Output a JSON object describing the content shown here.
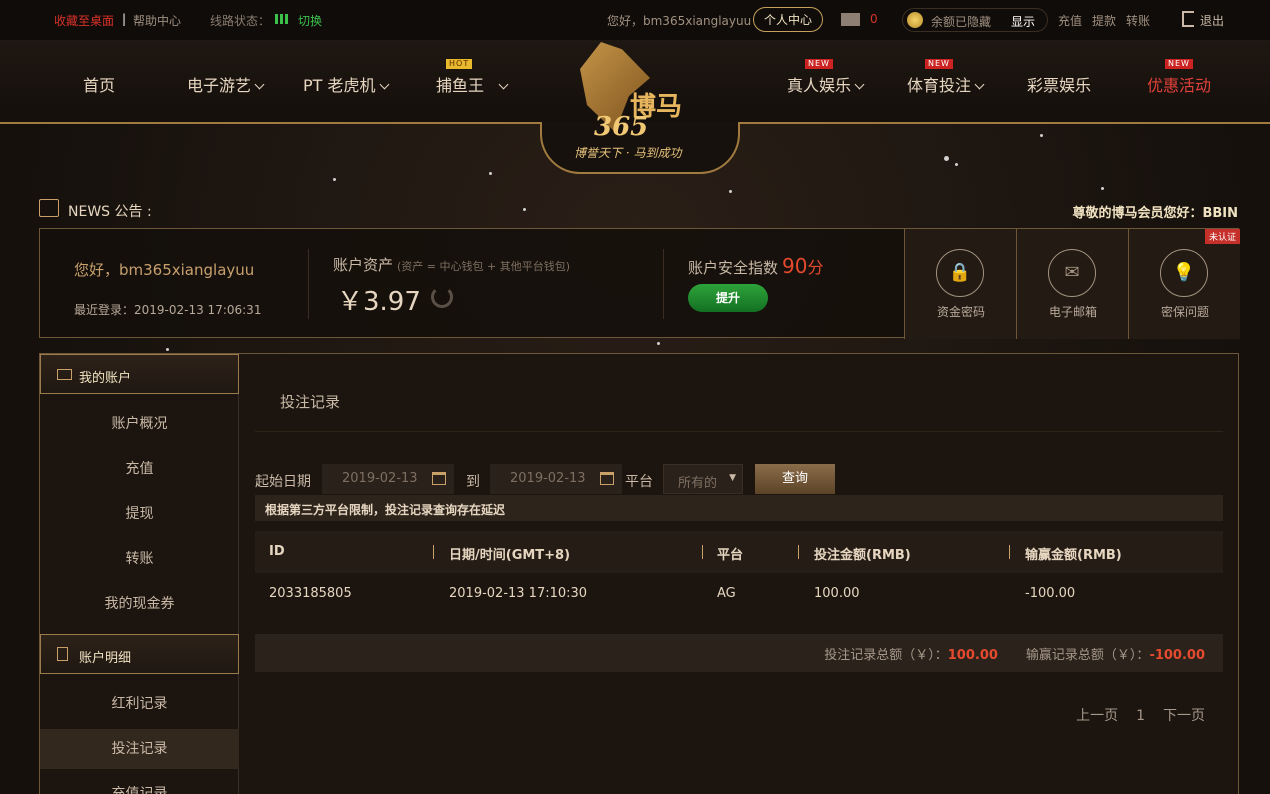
{
  "topbar": {
    "bookmark": "收藏至桌面",
    "separator": "|",
    "help": "帮助中心",
    "line_status": "线路状态：",
    "switch": "切换",
    "hello": "您好，bm365xianglayuu",
    "personal_center": "个人中心",
    "mail_count": "0",
    "balance_hidden": "余额已隐藏",
    "balance_show": "显示",
    "deposit": "充值",
    "withdraw": "提款",
    "transfer": "转账",
    "logout": "退出"
  },
  "nav": {
    "items": [
      {
        "label": "首页"
      },
      {
        "label": "电子游艺"
      },
      {
        "label": "PT 老虎机"
      },
      {
        "label": "捕鱼王",
        "badge": "HOT"
      },
      {
        "label": "真人娱乐",
        "badge": "NEW"
      },
      {
        "label": "体育投注",
        "badge": "NEW"
      },
      {
        "label": "彩票娱乐"
      },
      {
        "label": "优惠活动",
        "badge": "NEW"
      }
    ]
  },
  "logo": {
    "bo": "博马",
    "num": "365",
    "slogan": "博誉天下 · 马到成功"
  },
  "news": {
    "label": "NEWS 公告 :",
    "text": "尊敬的博马会员您好：BBIN"
  },
  "account": {
    "hello": "您好，bm365xianglayuu",
    "last_login": "最近登录：2019-02-13 17:06:31",
    "asset_title": "账户资产",
    "asset_note": "(资产 = 中心钱包 + 其他平台钱包)",
    "asset_value": "￥3.97",
    "security_title": "账户安全指数",
    "security_score": "90",
    "security_unit": "分",
    "upgrade": "提升",
    "unverified": "未认证",
    "security_items": [
      {
        "label": "资金密码",
        "icon": "lock-icon"
      },
      {
        "label": "电子邮箱",
        "icon": "mail-icon"
      },
      {
        "label": "密保问题",
        "icon": "bulb-icon"
      }
    ]
  },
  "sidebar": {
    "section1": "我的账户",
    "section1_items": [
      "账户概况",
      "充值",
      "提现",
      "转账",
      "我的现金券"
    ],
    "section2": "账户明细",
    "section2_items": [
      "红利记录",
      "投注记录",
      "充值记录"
    ]
  },
  "main": {
    "title": "投注记录",
    "start_label": "起始日期",
    "start_date": "2019-02-13",
    "to_label": "到",
    "end_date": "2019-02-13",
    "platform_label": "平台",
    "platform_value": "所有的",
    "query": "查询",
    "notice": "根据第三方平台限制，投注记录查询存在延迟",
    "columns": [
      "ID",
      "日期/时间(GMT+8)",
      "平台",
      "投注金额(RMB)",
      "输赢金额(RMB)"
    ],
    "rows": [
      [
        "2033185805",
        "2019-02-13 17:10:30",
        "AG",
        "100.00",
        "-100.00"
      ]
    ],
    "total_bet_label": "投注记录总额（￥）：",
    "total_bet": "100.00",
    "total_win_label": "输赢记录总额（￥）：",
    "total_win": "-100.00",
    "prev": "上一页",
    "page": "1",
    "next": "下一页"
  }
}
